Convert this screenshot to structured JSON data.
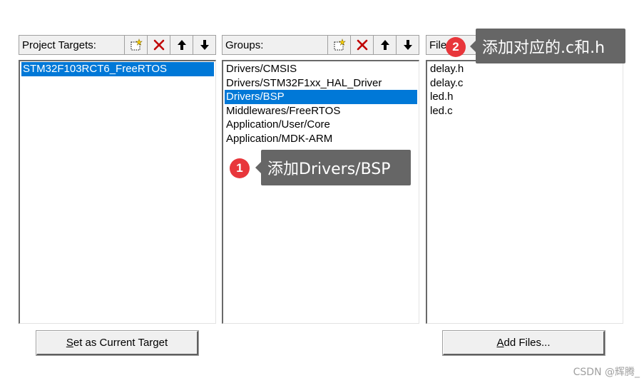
{
  "targets_panel": {
    "title": "Project Targets:",
    "items": [
      "STM32F103RCT6_FreeRTOS"
    ],
    "selected_index": 0
  },
  "groups_panel": {
    "title": "Groups:",
    "items": [
      "Drivers/CMSIS",
      "Drivers/STM32F1xx_HAL_Driver",
      "Drivers/BSP",
      "Middlewares/FreeRTOS",
      "Application/User/Core",
      "Application/MDK-ARM"
    ],
    "selected_index": 2
  },
  "files_panel": {
    "title": "Files:",
    "items": [
      "delay.h",
      "delay.c",
      "led.h",
      "led.c"
    ]
  },
  "toolbar_icons": [
    "new-icon",
    "delete-icon",
    "move-up-icon",
    "move-down-icon"
  ],
  "buttons": {
    "set_target": {
      "accel": "S",
      "rest": "et as Current Target"
    },
    "add_files": {
      "accel": "A",
      "rest": "dd Files..."
    }
  },
  "callouts": [
    {
      "step": "1",
      "text": "添加Drivers/BSP"
    },
    {
      "step": "2",
      "text": "添加对应的.c和.h"
    }
  ],
  "watermark": "CSDN @辉腾_",
  "colors": {
    "selection": "#0078d7",
    "callout_bg": "#666666",
    "badge": "#e8363b",
    "delete_x": "#c00000"
  }
}
